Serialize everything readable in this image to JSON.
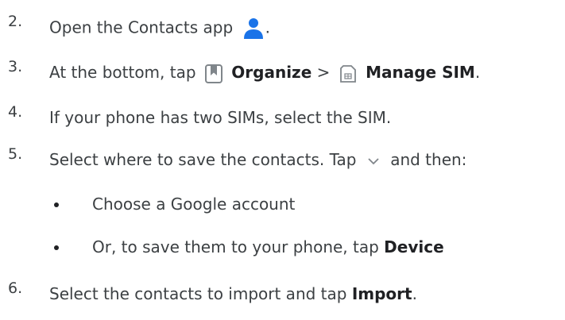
{
  "steps": [
    {
      "num": "2.",
      "text": "Open the Contacts app",
      "tail": "."
    },
    {
      "num": "3.",
      "pre": "At the bottom, tap",
      "b1": "Organize",
      "sep": ">",
      "b2": "Manage SIM",
      "tail": "."
    },
    {
      "num": "4.",
      "text": "If your phone has two SIMs, select the SIM."
    },
    {
      "num": "5.",
      "pre": "Select where to save the contacts. Tap",
      "post": "and then:"
    },
    {
      "num": "6.",
      "pre": "Select the contacts to import and tap",
      "b": "Import",
      "tail": "."
    }
  ],
  "bullets": [
    {
      "text": "Choose a Google account"
    },
    {
      "pre": "Or, to save them to your phone, tap",
      "b": "Device"
    }
  ],
  "icons": {
    "contacts": "contacts-person-icon",
    "organize": "organize-bookmark-icon",
    "manage_sim": "sim-card-icon",
    "dropdown": "chevron-down-icon"
  },
  "colors": {
    "text": "#3c4043",
    "bold": "#202124",
    "contacts_icon": "#1a73e8",
    "icon_gray": "#80868b"
  }
}
